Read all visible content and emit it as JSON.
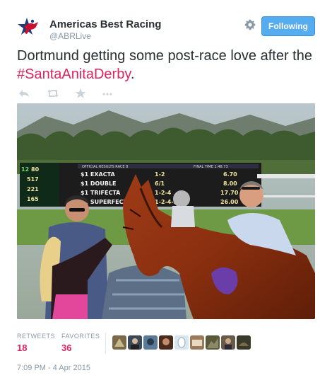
{
  "tweet": {
    "author": {
      "display_name": "Americas Best Racing",
      "handle": "@ABRLive"
    },
    "follow_button_label": "Following",
    "text_plain": "Dortmund getting some post-race love after the ",
    "hashtag": "#SantaAnitaDerby",
    "text_end": ".",
    "actions": [
      "reply-icon",
      "retweet-icon",
      "favorite-icon",
      "more-icon"
    ],
    "photo": {
      "board_rows": [
        {
          "label": "$1 EXACTA",
          "combo": "1-2",
          "payout": "6.70"
        },
        {
          "label": "$1 DOUBLE",
          "combo": "6/1",
          "payout": "8.00"
        },
        {
          "label": "$1 TRIFECTA",
          "combo": "1-2-4",
          "payout": "17.70"
        },
        {
          "label": "$1 SUPERFECTA",
          "combo": "1-2-4-3",
          "payout": "26.00"
        }
      ],
      "board_left_numbers": [
        "12",
        "80",
        "517",
        "221",
        "165"
      ],
      "board_header": "OFFICIAL RESULTS RACE 8",
      "board_time": "FINAL TIME 1:48.73"
    },
    "stats": {
      "retweets_label": "RETWEETS",
      "retweets_count": "18",
      "favorites_label": "FAVORITES",
      "favorites_count": "36"
    },
    "favoriters_count": 9,
    "timestamp": "7:09 PM - 4 Apr 2015"
  },
  "colors": {
    "accent": "#55acee",
    "hashtag": "#e0245e",
    "muted": "#8899a6",
    "text": "#292f33"
  }
}
